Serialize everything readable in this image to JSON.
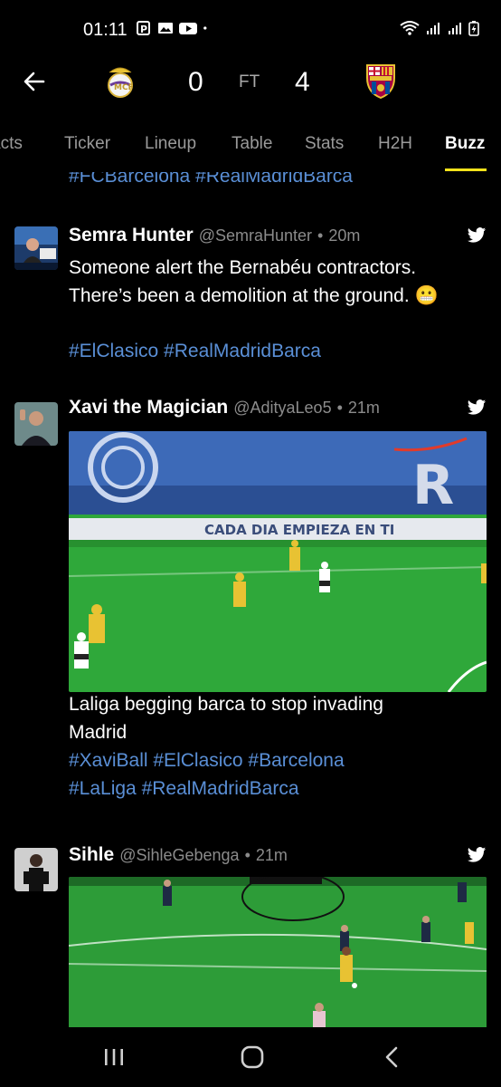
{
  "status_bar": {
    "time": "01:11",
    "left_icons": [
      "parking-app-icon",
      "gallery-icon",
      "youtube-icon",
      "dot-icon"
    ],
    "right_icons": [
      "wifi-icon",
      "signal-icon",
      "signal-icon",
      "battery-charging-icon"
    ]
  },
  "match": {
    "home_score": "0",
    "status": "FT",
    "away_score": "4",
    "home_crest": "real-madrid-crest",
    "away_crest": "barcelona-crest"
  },
  "tabs": [
    {
      "label": "acts"
    },
    {
      "label": "Ticker"
    },
    {
      "label": "Lineup"
    },
    {
      "label": "Table"
    },
    {
      "label": "Stats"
    },
    {
      "label": "H2H"
    },
    {
      "label": "Buzz",
      "active": true
    }
  ],
  "feed": {
    "cut_off_hashtags": "#FCBarcelona #RealMadridBarca",
    "tweets": [
      {
        "name": "Semra Hunter",
        "handle": "@SemraHunter",
        "sep": "•",
        "time": "20m",
        "text_line1": "Someone alert the Bernabéu contractors.",
        "text_line2": "There’s been a demolition at the ground. 😬",
        "hashtags": "#ElClasico #RealMadridBarca"
      },
      {
        "name": "Xavi the Magician",
        "handle": "@AdityaLeo5",
        "sep": "•",
        "time": "21m",
        "media_banner_text": "CADA DIA EMPIEZA EN TI",
        "text_line1": "Laliga begging barca to stop invading",
        "text_line2": "Madrid",
        "hashtags_line1": "#XaviBall #ElClasico #Barcelona",
        "hashtags_line2": "#LaLiga #RealMadridBarca"
      },
      {
        "name": "Sihle",
        "handle": "@SihleGebenga",
        "sep": "•",
        "time": "21m"
      }
    ]
  },
  "nav_bar": {
    "buttons": [
      "recent-apps-icon",
      "home-icon",
      "back-icon"
    ]
  },
  "colors": {
    "background": "#000000",
    "hashtag": "#5a8fd6",
    "tab_indicator": "#f4e21b",
    "muted_text": "#8b8b8b",
    "pitch_green": "#2fa83a",
    "barca_kit": "#e8c233",
    "twitter_blue": "#ffffff"
  }
}
